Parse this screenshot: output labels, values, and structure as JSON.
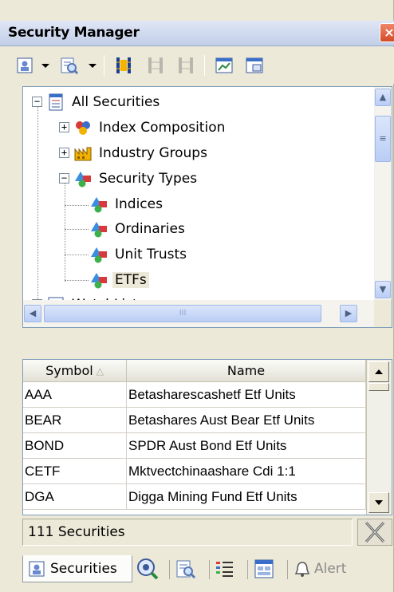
{
  "window": {
    "title": "Security Manager",
    "close_glyph": "×"
  },
  "toolbar": {
    "buttons": [
      "security-list-icon",
      "search-list-icon",
      "film-icon",
      "film-disabled-icon",
      "film-disabled-icon",
      "chart-properties-icon",
      "print-preview-icon"
    ]
  },
  "tree": {
    "items": [
      {
        "label": "All Securities",
        "icon": "securities-list-icon",
        "expander": "−"
      },
      {
        "label": "Index Composition",
        "icon": "index-balls-icon",
        "expander": "+"
      },
      {
        "label": "Industry Groups",
        "icon": "factory-icon",
        "expander": "+"
      },
      {
        "label": "Security Types",
        "icon": "shapes-icon",
        "expander": "−"
      },
      {
        "label": "Indices",
        "icon": "shapes-icon"
      },
      {
        "label": "Ordinaries",
        "icon": "shapes-icon"
      },
      {
        "label": "Unit Trusts",
        "icon": "shapes-icon"
      },
      {
        "label": "ETFs",
        "icon": "shapes-icon",
        "selected": true
      },
      {
        "label": "WatchLists",
        "icon": "watchlist-icon",
        "expander": "−"
      }
    ],
    "hscroll_grip": "III"
  },
  "grid": {
    "columns": [
      "Symbol",
      "Name"
    ],
    "sort_glyph": "△",
    "rows": [
      [
        "AAA",
        "Betasharescashetf Etf Units"
      ],
      [
        "BEAR",
        "Betashares Aust Bear Etf Units"
      ],
      [
        "BOND",
        "SPDR Aust Bond Etf Units"
      ],
      [
        "CETF",
        "Mktvectchinaashare Cdi 1:1"
      ],
      [
        "DGA",
        "Digga Mining Fund Etf Units"
      ]
    ]
  },
  "status": {
    "text": "111 Securities"
  },
  "tabs": [
    {
      "label": "Securities",
      "icon": "securities-tab-icon",
      "active": true
    },
    {
      "label": "",
      "icon": "search-eye-icon"
    },
    {
      "label": "",
      "icon": "search-list-icon"
    },
    {
      "label": "",
      "icon": "checklist-icon"
    },
    {
      "label": "",
      "icon": "window-grid-icon"
    },
    {
      "label": "Alert",
      "icon": "bell-icon"
    }
  ],
  "colors": {
    "window_bg": "#ece9d8",
    "selection_bg": "#ece9d8",
    "close_red": "#d34b27",
    "scroll_blue": "#b9cdf5"
  }
}
